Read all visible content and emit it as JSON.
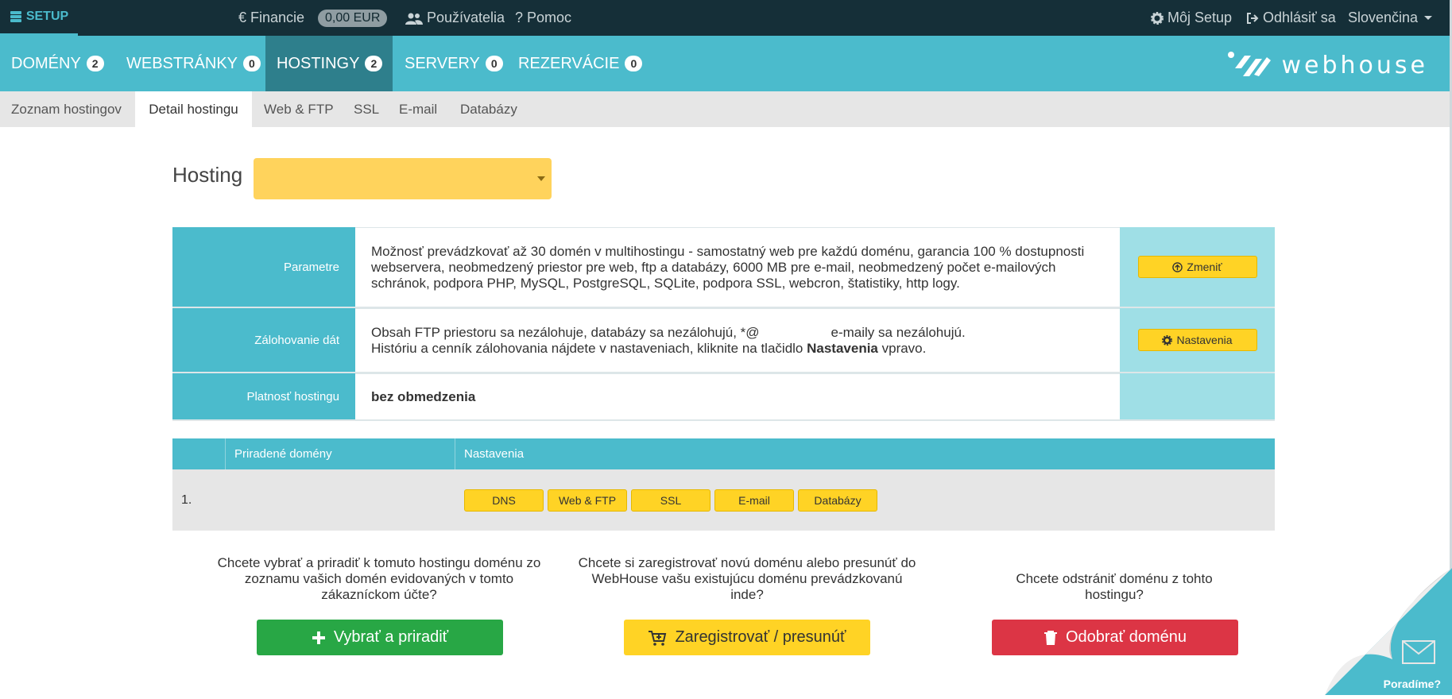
{
  "topbar": {
    "brand": "SETUP",
    "finance": "Financie",
    "balance": "0,00 EUR",
    "users": "Používatelia",
    "help": "Pomoc",
    "my_setup": "Môj Setup",
    "logout": "Odhlásiť sa",
    "language": "Slovenčina"
  },
  "nav": {
    "tabs": [
      {
        "label": "DOMÉNY",
        "count": "2"
      },
      {
        "label": "WEBSTRÁNKY",
        "count": "0"
      },
      {
        "label": "HOSTINGY",
        "count": "2"
      },
      {
        "label": "SERVERY",
        "count": "0"
      },
      {
        "label": "REZERVÁCIE",
        "count": "0"
      }
    ],
    "logo_text": "webhouse"
  },
  "subnav": {
    "tabs": [
      "Zoznam hostingov",
      "Detail hostingu",
      "Web & FTP",
      "SSL",
      "E-mail",
      "Databázy"
    ]
  },
  "hosting": {
    "label": "Hosting",
    "selected": ""
  },
  "params": {
    "parametre_label": "Parametre",
    "parametre_text": "Možnosť prevádzkovať až 30 domén v multihostingu - samostatný web pre každú doménu, garancia 100 % dostupnosti webservera, neobmedzený priestor pre web, ftp a databázy, 6000 MB pre e-mail, neobmedzený počet e-mailových schránok, podpora PHP, MySQL, PostgreSQL, SQLite, podpora SSL, webcron, štatistiky, http logy.",
    "zmenit_label": "Zmeniť",
    "backup_label": "Zálohovanie dát",
    "backup_line1_a": "Obsah FTP priestoru sa nezálohuje, databázy sa nezálohujú, *@",
    "backup_line1_b": "e-maily sa nezálohujú.",
    "backup_line2_a": "Históriu a cenník zálohovania nájdete v nastaveniach, kliknite na tlačidlo ",
    "backup_line2_bold": "Nastavenia",
    "backup_line2_b": " vpravo.",
    "nastavenia_label": "Nastavenia",
    "validity_label": "Platnosť hostingu",
    "validity_value": "bez obmedzenia"
  },
  "domains": {
    "col_assigned": "Priradené domény",
    "col_settings": "Nastavenia",
    "rows": [
      {
        "index": "1.",
        "domain": ""
      }
    ],
    "buttons": [
      "DNS",
      "Web & FTP",
      "SSL",
      "E-mail",
      "Databázy"
    ]
  },
  "cta": {
    "assign_text": "Chcete vybrať a priradiť k tomuto hostingu doménu zo zoznamu vašich domén evidovaných v tomto zákazníckom účte?",
    "assign_button": "Vybrať a priradiť",
    "register_text": "Chcete si zaregistrovať novú doménu alebo presunúť do WebHouse vašu existujúcu doménu prevádzkovanú inde?",
    "register_button": "Zaregistrovať / presunúť",
    "remove_text": "Chcete odstrániť doménu z tohto hostingu?",
    "remove_button": "Odobrať doménu"
  },
  "help_corner": "Poradíme?",
  "colors": {
    "topbar": "#152f38",
    "primary": "#4bbbcc",
    "primary_dark": "#2e7f8c",
    "accent_yellow": "#ffd325",
    "green": "#28a745",
    "red": "#dc3545"
  }
}
